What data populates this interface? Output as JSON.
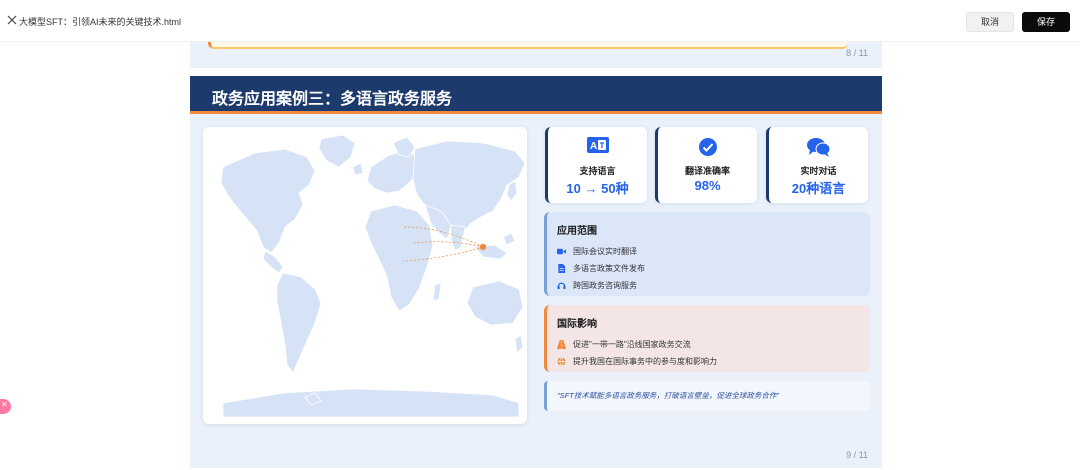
{
  "topbar": {
    "file_title": "大模型SFT：引领AI未来的关键技术.html",
    "cancel_label": "取消",
    "save_label": "保存"
  },
  "previous_slide": {
    "page": "8 / 11"
  },
  "slide": {
    "title": "政务应用案例三：多语言政务服务",
    "page": "9 / 11",
    "stats": [
      {
        "icon": "translate-icon",
        "label": "支持语言",
        "value": "10 → 50种"
      },
      {
        "icon": "check-circle-icon",
        "label": "翻译准确率",
        "value": "98%"
      },
      {
        "icon": "chat-bubbles-icon",
        "label": "实时对话",
        "value": "20种语言"
      }
    ],
    "apply": {
      "title": "应用范围",
      "items": [
        {
          "icon": "video-icon",
          "text": "国际会议实时翻译"
        },
        {
          "icon": "document-icon",
          "text": "多语言政策文件发布"
        },
        {
          "icon": "headset-icon",
          "text": "跨国政务咨询服务"
        }
      ]
    },
    "impact": {
      "title": "国际影响",
      "items": [
        {
          "icon": "road-icon",
          "text": "促进\"一带一路\"沿线国家政务交流"
        },
        {
          "icon": "globe-icon",
          "text": "提升我国在国际事务中的参与度和影响力"
        }
      ]
    },
    "quote": "\"SFT技术赋能多语言政务服务，打破语言壁垒，促进全球政务合作\""
  },
  "colors": {
    "header": "#1c3a6b",
    "accent": "#f08a3c",
    "value_blue": "#2563eb",
    "map_land": "#d6e2f5"
  }
}
